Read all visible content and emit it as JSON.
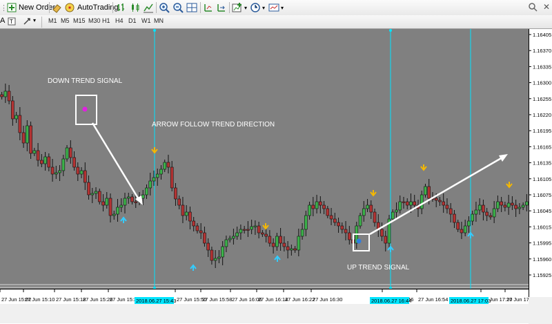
{
  "toolbar": {
    "new_order_label": "New Order",
    "autotrading_label": "AutoTrading",
    "timeframes": [
      "M1",
      "M5",
      "M15",
      "M30",
      "H1",
      "H4",
      "D1",
      "W1",
      "MN"
    ]
  },
  "chart": {
    "annotations": {
      "down_trend": "DOWN TREND SIGNAL",
      "arrow_follow": "ARROW FOLLOW TREND DIRECTION",
      "up_trend": "UP TREND SIGNAL"
    },
    "price_labels": [
      "1.16405",
      "1.16370",
      "1.16335",
      "1.16300",
      "1.16255",
      "1.16220",
      "1.16195",
      "1.16165",
      "1.16135",
      "1.16105",
      "1.16075",
      "1.16045",
      "1.16015",
      "1.15995",
      "1.15960",
      "1.15925"
    ],
    "time_labels": [
      "27 Jun 15:02",
      "27 Jun 15:10",
      "27 Jun 15:18",
      "27 Jun 15:26",
      "27 Jun 15:34",
      "27 Jun 15:50",
      "27 Jun 15:58",
      "27 Jun 16:06",
      "27 Jun 16:14",
      "27 Jun 16:22",
      "27 Jun 16:30",
      "27 Jun 16:46",
      "27 Jun 16:54",
      "27 Jun 17:10",
      "27 Jun 17:18"
    ],
    "highlighted_times": [
      "2018.06.27 15:43",
      "2018.06.27 16:44",
      "2018.06.27 17:03"
    ],
    "colors": {
      "background": "#808080",
      "bull": "#3cb14a",
      "bear": "#b33333",
      "vline": "#00e5ff",
      "up_arrow": "#33ccff",
      "down_arrow": "#f5b800"
    }
  }
}
